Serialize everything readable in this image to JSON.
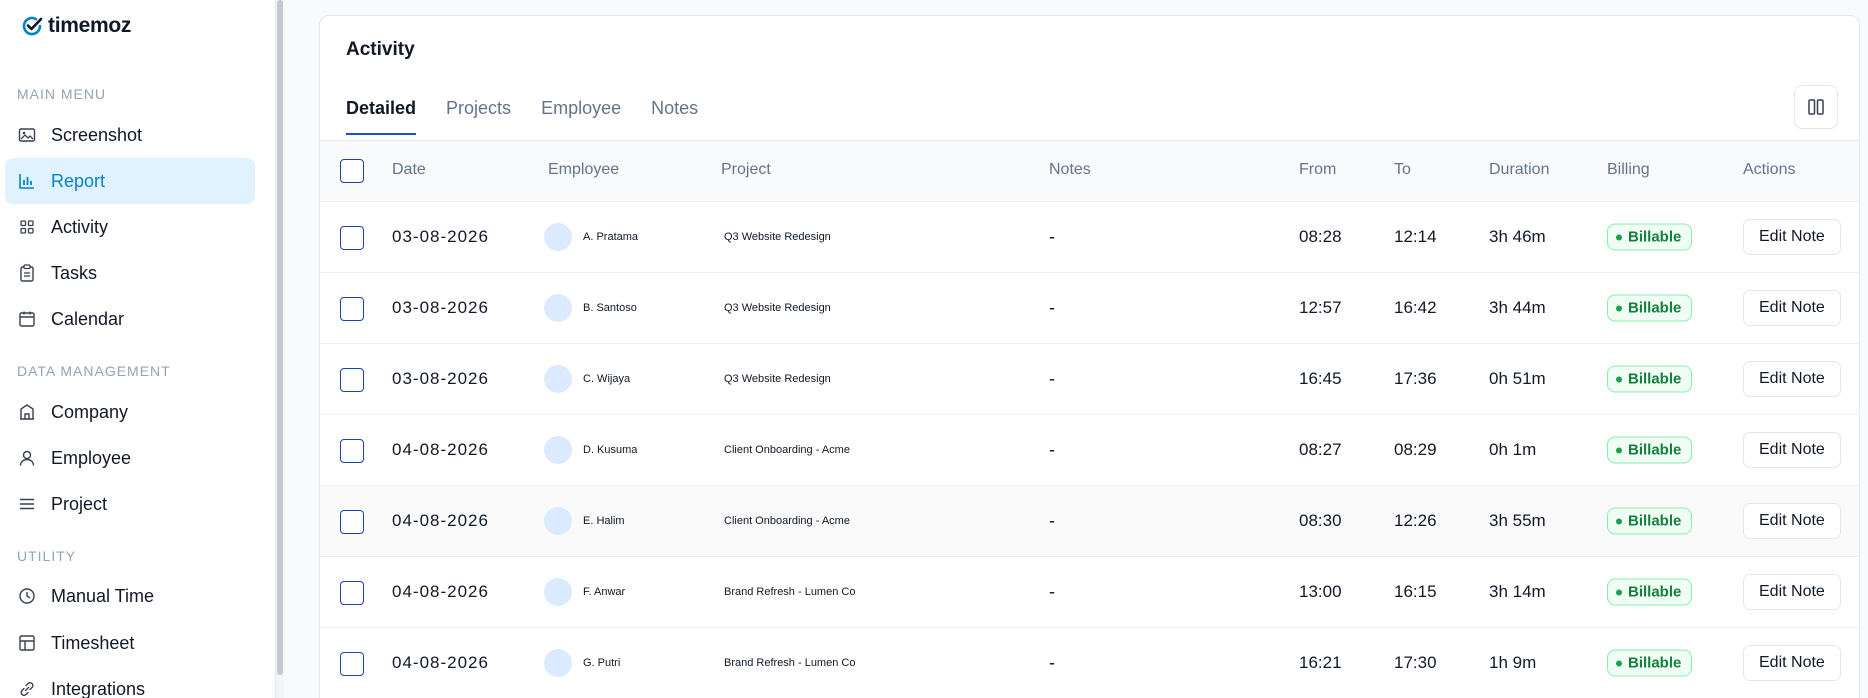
{
  "app": {
    "name": "timemoz",
    "brand_color": "#0284c7"
  },
  "sidebar": {
    "sections": [
      {
        "title": "MAIN MENU"
      },
      {
        "title": "DATA MANAGEMENT"
      },
      {
        "title": "UTILITY"
      }
    ],
    "items": [
      {
        "label": "Screenshot",
        "icon": "image-icon",
        "active": false
      },
      {
        "label": "Report",
        "icon": "bar-chart-icon",
        "active": true
      },
      {
        "label": "Activity",
        "icon": "grid-icon",
        "active": false
      },
      {
        "label": "Tasks",
        "icon": "clipboard-icon",
        "active": false
      },
      {
        "label": "Calendar",
        "icon": "calendar-icon",
        "active": false
      },
      {
        "label": "Company",
        "icon": "building-icon",
        "active": false
      },
      {
        "label": "Employee",
        "icon": "user-icon",
        "active": false
      },
      {
        "label": "Project",
        "icon": "list-icon",
        "active": false
      },
      {
        "label": "Manual Time",
        "icon": "clock-icon",
        "active": false
      },
      {
        "label": "Timesheet",
        "icon": "table-icon",
        "active": false
      },
      {
        "label": "Integrations",
        "icon": "link-icon",
        "active": false
      }
    ]
  },
  "main": {
    "title": "Activity",
    "tabs": [
      {
        "label": "Detailed",
        "active": true
      },
      {
        "label": "Projects",
        "active": false
      },
      {
        "label": "Employee",
        "active": false
      },
      {
        "label": "Notes",
        "active": false
      }
    ],
    "table": {
      "headers": [
        "Date",
        "Employee",
        "Project",
        "Notes",
        "From",
        "To",
        "Duration",
        "Billing",
        "Actions"
      ],
      "rows": [
        {
          "date": "03-08-2026",
          "employee": "A. Pratama",
          "project": "Q3 Website Redesign",
          "notes": "-",
          "from": "08:28",
          "to": "12:14",
          "duration": "3h 46m",
          "billing": "Billable",
          "action": "Edit Note"
        },
        {
          "date": "03-08-2026",
          "employee": "B. Santoso",
          "project": "Q3 Website Redesign",
          "notes": "-",
          "from": "12:57",
          "to": "16:42",
          "duration": "3h 44m",
          "billing": "Billable",
          "action": "Edit Note"
        },
        {
          "date": "03-08-2026",
          "employee": "C. Wijaya",
          "project": "Q3 Website Redesign",
          "notes": "-",
          "from": "16:45",
          "to": "17:36",
          "duration": "0h 51m",
          "billing": "Billable",
          "action": "Edit Note"
        },
        {
          "date": "04-08-2026",
          "employee": "D. Kusuma",
          "project": "Client Onboarding - Acme",
          "notes": "-",
          "from": "08:27",
          "to": "08:29",
          "duration": "0h 1m",
          "billing": "Billable",
          "action": "Edit Note"
        },
        {
          "date": "04-08-2026",
          "employee": "E. Halim",
          "project": "Client Onboarding - Acme",
          "notes": "-",
          "from": "08:30",
          "to": "12:26",
          "duration": "3h 55m",
          "billing": "Billable",
          "action": "Edit Note"
        },
        {
          "date": "04-08-2026",
          "employee": "F. Anwar",
          "project": "Brand Refresh - Lumen Co",
          "notes": "-",
          "from": "13:00",
          "to": "16:15",
          "duration": "3h 14m",
          "billing": "Billable",
          "action": "Edit Note"
        },
        {
          "date": "04-08-2026",
          "employee": "G. Putri",
          "project": "Brand Refresh - Lumen Co",
          "notes": "-",
          "from": "16:21",
          "to": "17:30",
          "duration": "1h 9m",
          "billing": "Billable",
          "action": "Edit Note"
        }
      ]
    }
  }
}
